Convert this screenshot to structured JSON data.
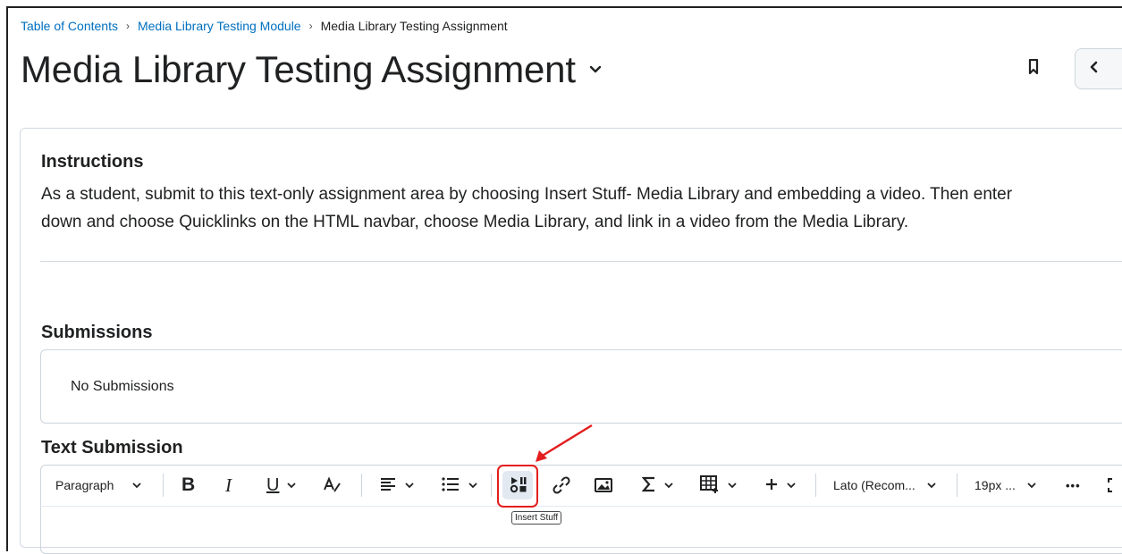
{
  "breadcrumb": {
    "items": [
      "Table of Contents",
      "Media Library Testing Module"
    ],
    "current": "Media Library Testing Assignment",
    "separator": "›"
  },
  "page": {
    "title": "Media Library Testing Assignment"
  },
  "instructions": {
    "heading": "Instructions",
    "line1": "As a student, submit to this text-only assignment area by choosing Insert Stuff- Media Library and embedding a video. Then enter",
    "line2": "down and choose Quicklinks on the HTML navbar, choose Media Library, and link in a video from the Media Library."
  },
  "submissions": {
    "heading": "Submissions",
    "empty_text": "No Submissions"
  },
  "text_submission": {
    "heading": "Text Submission",
    "toolbar": {
      "block_format": "Paragraph",
      "bold": "B",
      "italic": "I",
      "underline": "U",
      "font_family": "Lato (Recom...",
      "font_size": "19px ...",
      "more": "•••",
      "insert_stuff_tooltip": "Insert Stuff"
    }
  },
  "colors": {
    "link": "#006fbf",
    "highlight": "#e41e1e",
    "text": "#202122"
  }
}
